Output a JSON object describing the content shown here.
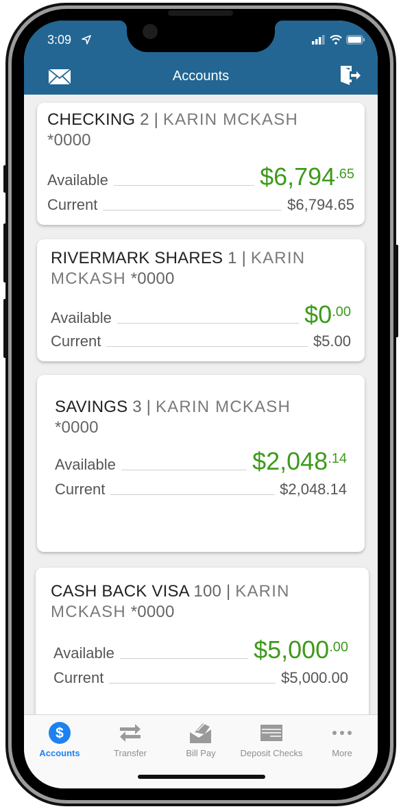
{
  "status_bar": {
    "time": "3:09"
  },
  "header": {
    "title": "Accounts",
    "left_icon": "mail-icon",
    "right_icon": "logout-icon"
  },
  "accounts": [
    {
      "name": "CHECKING",
      "number": "2",
      "separator": "|",
      "owner": "KARIN MCKASH",
      "masked": "*0000",
      "available_label": "Available",
      "available_dollars": "$6,794",
      "available_cents": ".65",
      "current_label": "Current",
      "current_amount": "$6,794.65"
    },
    {
      "name": "RIVERMARK SHARES",
      "number": "1",
      "separator": "|",
      "owner": "KARIN MCKASH",
      "masked": "*0000",
      "available_label": "Available",
      "available_dollars": "$0",
      "available_cents": ".00",
      "current_label": "Current",
      "current_amount": "$5.00"
    },
    {
      "name": "SAVINGS",
      "number": "3",
      "separator": "|",
      "owner": "KARIN MCKASH",
      "masked": "*0000",
      "available_label": "Available",
      "available_dollars": "$2,048",
      "available_cents": ".14",
      "current_label": "Current",
      "current_amount": "$2,048.14"
    },
    {
      "name": "CASH BACK VISA",
      "number": "100",
      "separator": "|",
      "owner": "KARIN MCKASH",
      "masked": "*0000",
      "available_label": "Available",
      "available_dollars": "$5,000",
      "available_cents": ".00",
      "current_label": "Current",
      "current_amount": "$5,000.00"
    }
  ],
  "tabbar": {
    "items": [
      {
        "label": "Accounts",
        "icon": "dollar-circle-icon",
        "active": true
      },
      {
        "label": "Transfer",
        "icon": "transfer-arrows-icon",
        "active": false
      },
      {
        "label": "Bill Pay",
        "icon": "bill-pay-icon",
        "active": false
      },
      {
        "label": "Deposit Checks",
        "icon": "check-icon",
        "active": false
      },
      {
        "label": "More",
        "icon": "more-dots-icon",
        "active": false
      }
    ]
  },
  "colors": {
    "header": "#236693",
    "positive": "#3e9a1c",
    "active_tab": "#1d82f0",
    "inactive_tab": "#8e8e8e"
  }
}
